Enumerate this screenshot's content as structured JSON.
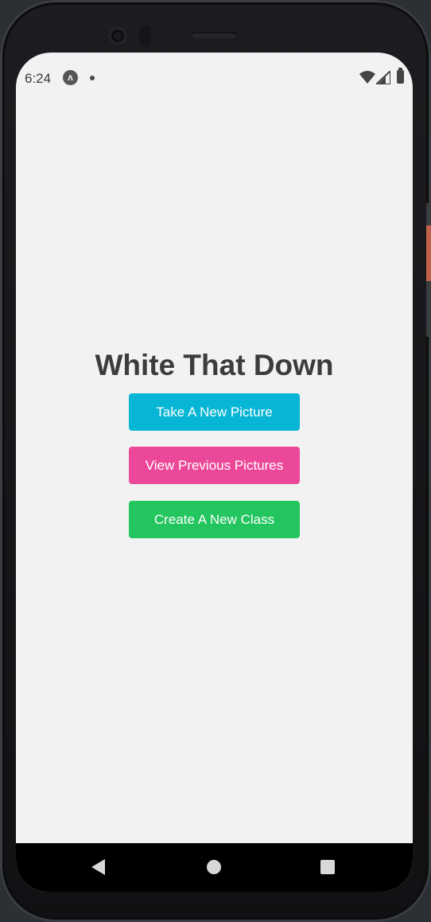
{
  "status_bar": {
    "time": "6:24",
    "notification_icon": "app-notification-icon",
    "notification_glyph": "ʌ"
  },
  "main": {
    "title": "White That Down",
    "buttons": [
      {
        "label": "Take A New Picture",
        "color": "#06b6d4"
      },
      {
        "label": "View Previous Pictures",
        "color": "#ec4899"
      },
      {
        "label": "Create A New Class",
        "color": "#22c55e"
      }
    ]
  },
  "colors": {
    "background": "#f2f2f2",
    "title": "#3c3c3c",
    "navbar": "#000000"
  },
  "navbar": {
    "icons": [
      "back-icon",
      "home-icon",
      "recents-icon"
    ]
  }
}
